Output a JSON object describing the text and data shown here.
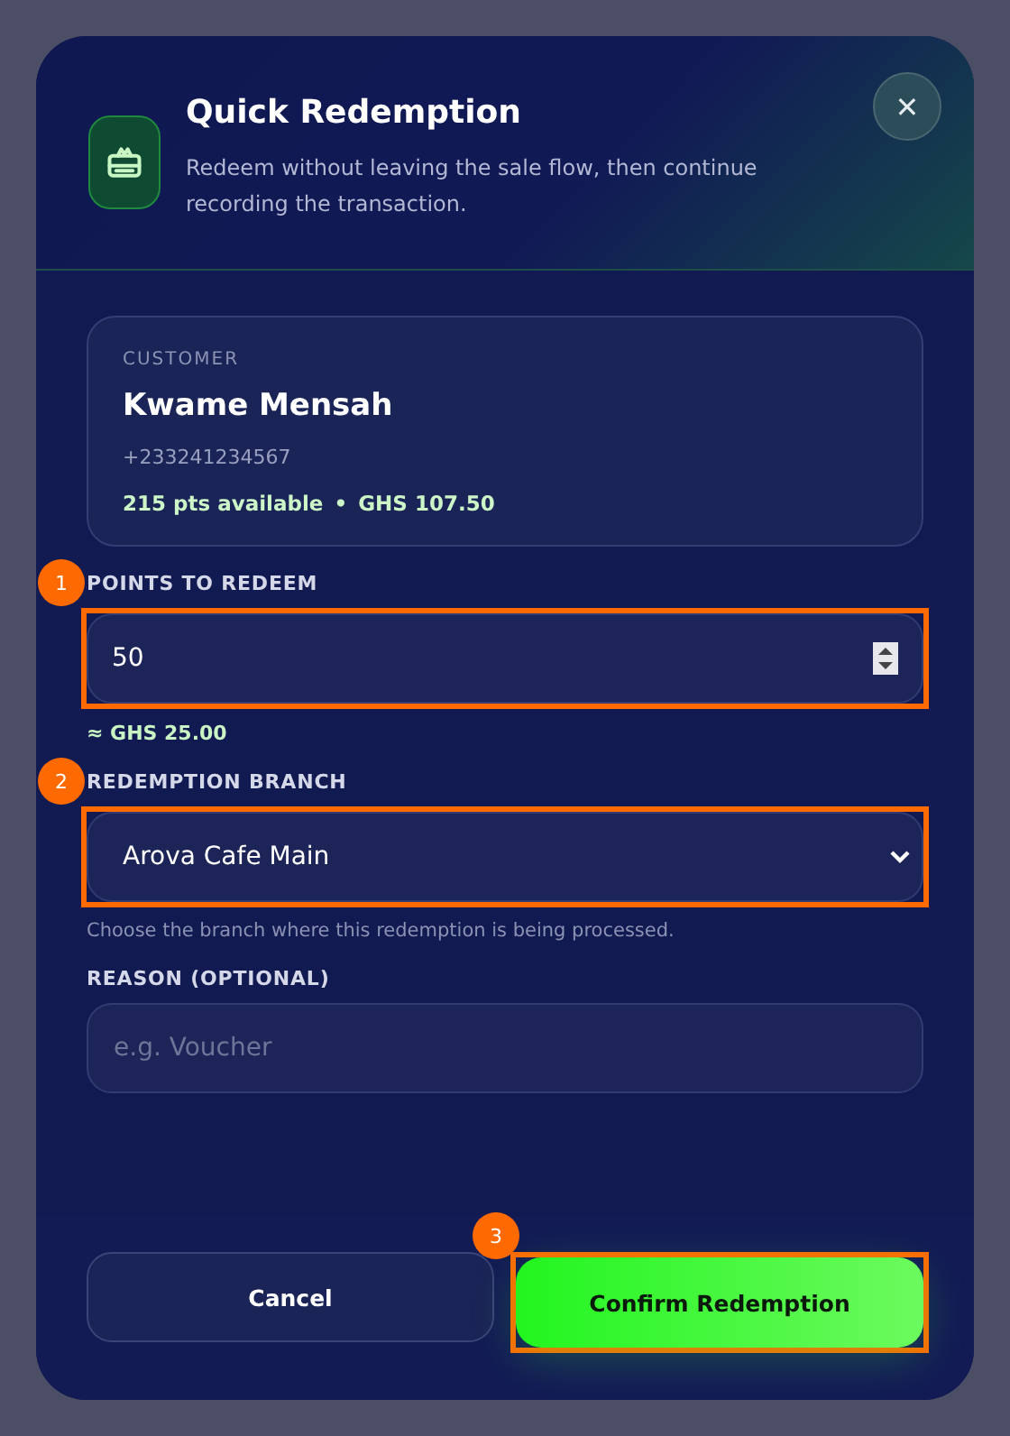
{
  "dialog": {
    "title": "Quick Redemption",
    "subtitle": "Redeem without leaving the sale flow, then continue recording the transaction.",
    "close": "✕"
  },
  "customer": {
    "caption": "CUSTOMER",
    "name": "Kwame Mensah",
    "phone": "+233241234567",
    "points": "215 pts available",
    "separator": "•",
    "value": "GHS 107.50"
  },
  "points_field": {
    "label": "POINTS TO REDEEM",
    "value": "50",
    "callout": "1",
    "equivalent": "≈ GHS 25.00"
  },
  "branch_field": {
    "label": "REDEMPTION BRANCH",
    "value": "Arova Cafe Main",
    "callout": "2",
    "hint": "Choose the branch where this redemption is being processed."
  },
  "reason_field": {
    "label": "REASON (OPTIONAL)",
    "placeholder": "e.g. Voucher"
  },
  "buttons": [
    {
      "label": "Cancel",
      "kind": "secondary"
    },
    {
      "label": "Confirm Redemption",
      "kind": "primary",
      "callout": "3"
    }
  ]
}
